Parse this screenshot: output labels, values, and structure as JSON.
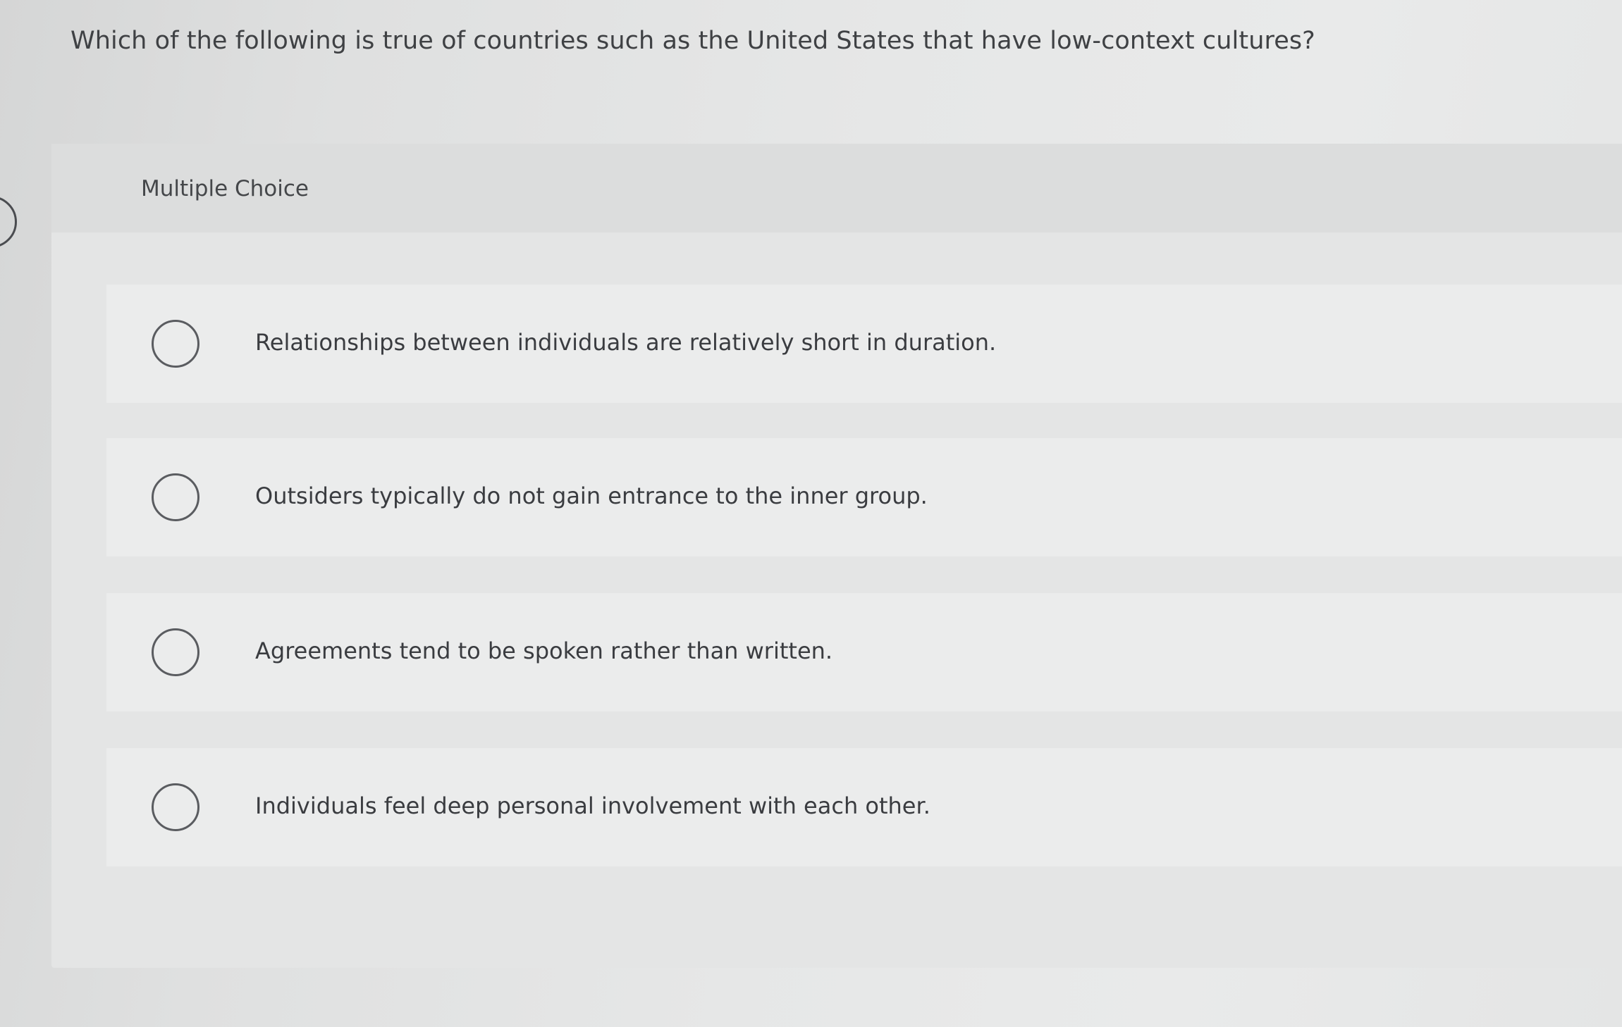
{
  "question": {
    "text": "Which of the following is true of countries such as the United States that have low-context cultures?"
  },
  "card": {
    "title": "Multiple Choice",
    "options": [
      {
        "label": "Relationships between individuals are relatively short in duration.",
        "selected": false
      },
      {
        "label": "Outsiders typically do not gain entrance to the inner group.",
        "selected": false
      },
      {
        "label": "Agreements tend to be spoken rather than written.",
        "selected": false
      },
      {
        "label": "Individuals feel deep personal involvement with each other.",
        "selected": false
      }
    ]
  },
  "icons": {
    "prev": "previous-question-icon",
    "radio": "radio-unselected-icon"
  },
  "colors": {
    "background": "#e6e7e7",
    "card": "#e4e5e5",
    "card_header": "#dcdddd",
    "option_row": "#ebecec",
    "text": "#3f4144",
    "radio_border": "#5a5c60"
  }
}
